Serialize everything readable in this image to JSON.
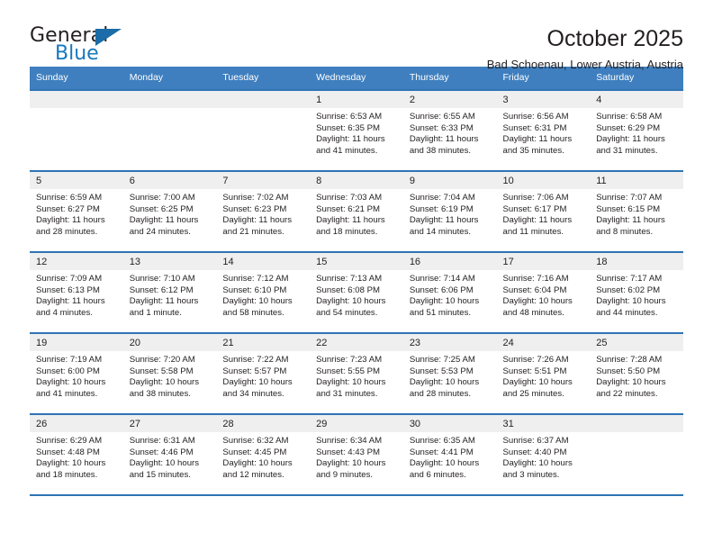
{
  "brand": {
    "word_one": "General",
    "word_two": "Blue",
    "accent_color": "#1878be"
  },
  "header": {
    "title": "October 2025",
    "subtitle": "Bad Schoenau, Lower Austria, Austria"
  },
  "theme": {
    "header_bar": "#3f7fbf",
    "rule": "#2f74b5",
    "daynum_band": "#efefef",
    "text": "#231f20"
  },
  "weekdays": [
    "Sunday",
    "Monday",
    "Tuesday",
    "Wednesday",
    "Thursday",
    "Friday",
    "Saturday"
  ],
  "labels": {
    "sunrise_prefix": "Sunrise:",
    "sunset_prefix": "Sunset:",
    "daylight_prefix": "Daylight:"
  },
  "weeks": [
    [
      {
        "empty": true
      },
      {
        "empty": true
      },
      {
        "empty": true
      },
      {
        "day": "1",
        "sunrise": "Sunrise: 6:53 AM",
        "sunset": "Sunset: 6:35 PM",
        "daylight": "Daylight: 11 hours and 41 minutes."
      },
      {
        "day": "2",
        "sunrise": "Sunrise: 6:55 AM",
        "sunset": "Sunset: 6:33 PM",
        "daylight": "Daylight: 11 hours and 38 minutes."
      },
      {
        "day": "3",
        "sunrise": "Sunrise: 6:56 AM",
        "sunset": "Sunset: 6:31 PM",
        "daylight": "Daylight: 11 hours and 35 minutes."
      },
      {
        "day": "4",
        "sunrise": "Sunrise: 6:58 AM",
        "sunset": "Sunset: 6:29 PM",
        "daylight": "Daylight: 11 hours and 31 minutes."
      }
    ],
    [
      {
        "day": "5",
        "sunrise": "Sunrise: 6:59 AM",
        "sunset": "Sunset: 6:27 PM",
        "daylight": "Daylight: 11 hours and 28 minutes."
      },
      {
        "day": "6",
        "sunrise": "Sunrise: 7:00 AM",
        "sunset": "Sunset: 6:25 PM",
        "daylight": "Daylight: 11 hours and 24 minutes."
      },
      {
        "day": "7",
        "sunrise": "Sunrise: 7:02 AM",
        "sunset": "Sunset: 6:23 PM",
        "daylight": "Daylight: 11 hours and 21 minutes."
      },
      {
        "day": "8",
        "sunrise": "Sunrise: 7:03 AM",
        "sunset": "Sunset: 6:21 PM",
        "daylight": "Daylight: 11 hours and 18 minutes."
      },
      {
        "day": "9",
        "sunrise": "Sunrise: 7:04 AM",
        "sunset": "Sunset: 6:19 PM",
        "daylight": "Daylight: 11 hours and 14 minutes."
      },
      {
        "day": "10",
        "sunrise": "Sunrise: 7:06 AM",
        "sunset": "Sunset: 6:17 PM",
        "daylight": "Daylight: 11 hours and 11 minutes."
      },
      {
        "day": "11",
        "sunrise": "Sunrise: 7:07 AM",
        "sunset": "Sunset: 6:15 PM",
        "daylight": "Daylight: 11 hours and 8 minutes."
      }
    ],
    [
      {
        "day": "12",
        "sunrise": "Sunrise: 7:09 AM",
        "sunset": "Sunset: 6:13 PM",
        "daylight": "Daylight: 11 hours and 4 minutes."
      },
      {
        "day": "13",
        "sunrise": "Sunrise: 7:10 AM",
        "sunset": "Sunset: 6:12 PM",
        "daylight": "Daylight: 11 hours and 1 minute."
      },
      {
        "day": "14",
        "sunrise": "Sunrise: 7:12 AM",
        "sunset": "Sunset: 6:10 PM",
        "daylight": "Daylight: 10 hours and 58 minutes."
      },
      {
        "day": "15",
        "sunrise": "Sunrise: 7:13 AM",
        "sunset": "Sunset: 6:08 PM",
        "daylight": "Daylight: 10 hours and 54 minutes."
      },
      {
        "day": "16",
        "sunrise": "Sunrise: 7:14 AM",
        "sunset": "Sunset: 6:06 PM",
        "daylight": "Daylight: 10 hours and 51 minutes."
      },
      {
        "day": "17",
        "sunrise": "Sunrise: 7:16 AM",
        "sunset": "Sunset: 6:04 PM",
        "daylight": "Daylight: 10 hours and 48 minutes."
      },
      {
        "day": "18",
        "sunrise": "Sunrise: 7:17 AM",
        "sunset": "Sunset: 6:02 PM",
        "daylight": "Daylight: 10 hours and 44 minutes."
      }
    ],
    [
      {
        "day": "19",
        "sunrise": "Sunrise: 7:19 AM",
        "sunset": "Sunset: 6:00 PM",
        "daylight": "Daylight: 10 hours and 41 minutes."
      },
      {
        "day": "20",
        "sunrise": "Sunrise: 7:20 AM",
        "sunset": "Sunset: 5:58 PM",
        "daylight": "Daylight: 10 hours and 38 minutes."
      },
      {
        "day": "21",
        "sunrise": "Sunrise: 7:22 AM",
        "sunset": "Sunset: 5:57 PM",
        "daylight": "Daylight: 10 hours and 34 minutes."
      },
      {
        "day": "22",
        "sunrise": "Sunrise: 7:23 AM",
        "sunset": "Sunset: 5:55 PM",
        "daylight": "Daylight: 10 hours and 31 minutes."
      },
      {
        "day": "23",
        "sunrise": "Sunrise: 7:25 AM",
        "sunset": "Sunset: 5:53 PM",
        "daylight": "Daylight: 10 hours and 28 minutes."
      },
      {
        "day": "24",
        "sunrise": "Sunrise: 7:26 AM",
        "sunset": "Sunset: 5:51 PM",
        "daylight": "Daylight: 10 hours and 25 minutes."
      },
      {
        "day": "25",
        "sunrise": "Sunrise: 7:28 AM",
        "sunset": "Sunset: 5:50 PM",
        "daylight": "Daylight: 10 hours and 22 minutes."
      }
    ],
    [
      {
        "day": "26",
        "sunrise": "Sunrise: 6:29 AM",
        "sunset": "Sunset: 4:48 PM",
        "daylight": "Daylight: 10 hours and 18 minutes."
      },
      {
        "day": "27",
        "sunrise": "Sunrise: 6:31 AM",
        "sunset": "Sunset: 4:46 PM",
        "daylight": "Daylight: 10 hours and 15 minutes."
      },
      {
        "day": "28",
        "sunrise": "Sunrise: 6:32 AM",
        "sunset": "Sunset: 4:45 PM",
        "daylight": "Daylight: 10 hours and 12 minutes."
      },
      {
        "day": "29",
        "sunrise": "Sunrise: 6:34 AM",
        "sunset": "Sunset: 4:43 PM",
        "daylight": "Daylight: 10 hours and 9 minutes."
      },
      {
        "day": "30",
        "sunrise": "Sunrise: 6:35 AM",
        "sunset": "Sunset: 4:41 PM",
        "daylight": "Daylight: 10 hours and 6 minutes."
      },
      {
        "day": "31",
        "sunrise": "Sunrise: 6:37 AM",
        "sunset": "Sunset: 4:40 PM",
        "daylight": "Daylight: 10 hours and 3 minutes."
      },
      {
        "empty": true
      }
    ]
  ]
}
